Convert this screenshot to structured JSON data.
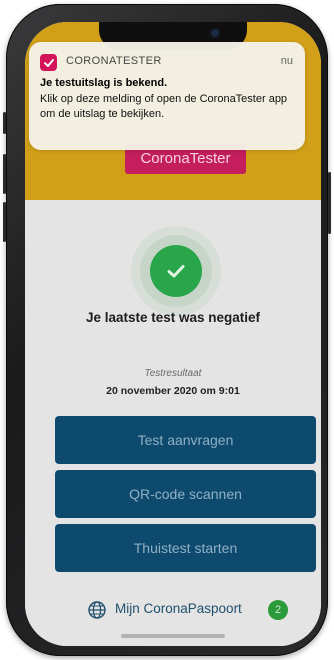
{
  "notification": {
    "app_name": "CORONATESTER",
    "time": "nu",
    "title": "Je testuitslag is bekend.",
    "body": "Klik op deze melding of open de CoronaTester app om de uitslag te bekijken.",
    "app_icon": "checkmark-icon",
    "app_icon_color": "#d3145a"
  },
  "header": {
    "brand_label": "CoronaTester",
    "background_color": "#d1a018"
  },
  "result": {
    "status_icon": "check-circle-icon",
    "title": "Je laatste test was negatief",
    "label": "Testresultaat",
    "date": "20 november 2020 om 9:01",
    "status_color": "#2aa64a"
  },
  "actions": [
    {
      "label": "Test aanvragen"
    },
    {
      "label": "QR-code scannen"
    },
    {
      "label": "Thuistest starten"
    }
  ],
  "bottom": {
    "icon": "globe-icon",
    "label": "Mijn CoronaPaspoort",
    "badge": "2"
  },
  "colors": {
    "button": "#0e4a6e",
    "accent": "#c41f5c"
  }
}
